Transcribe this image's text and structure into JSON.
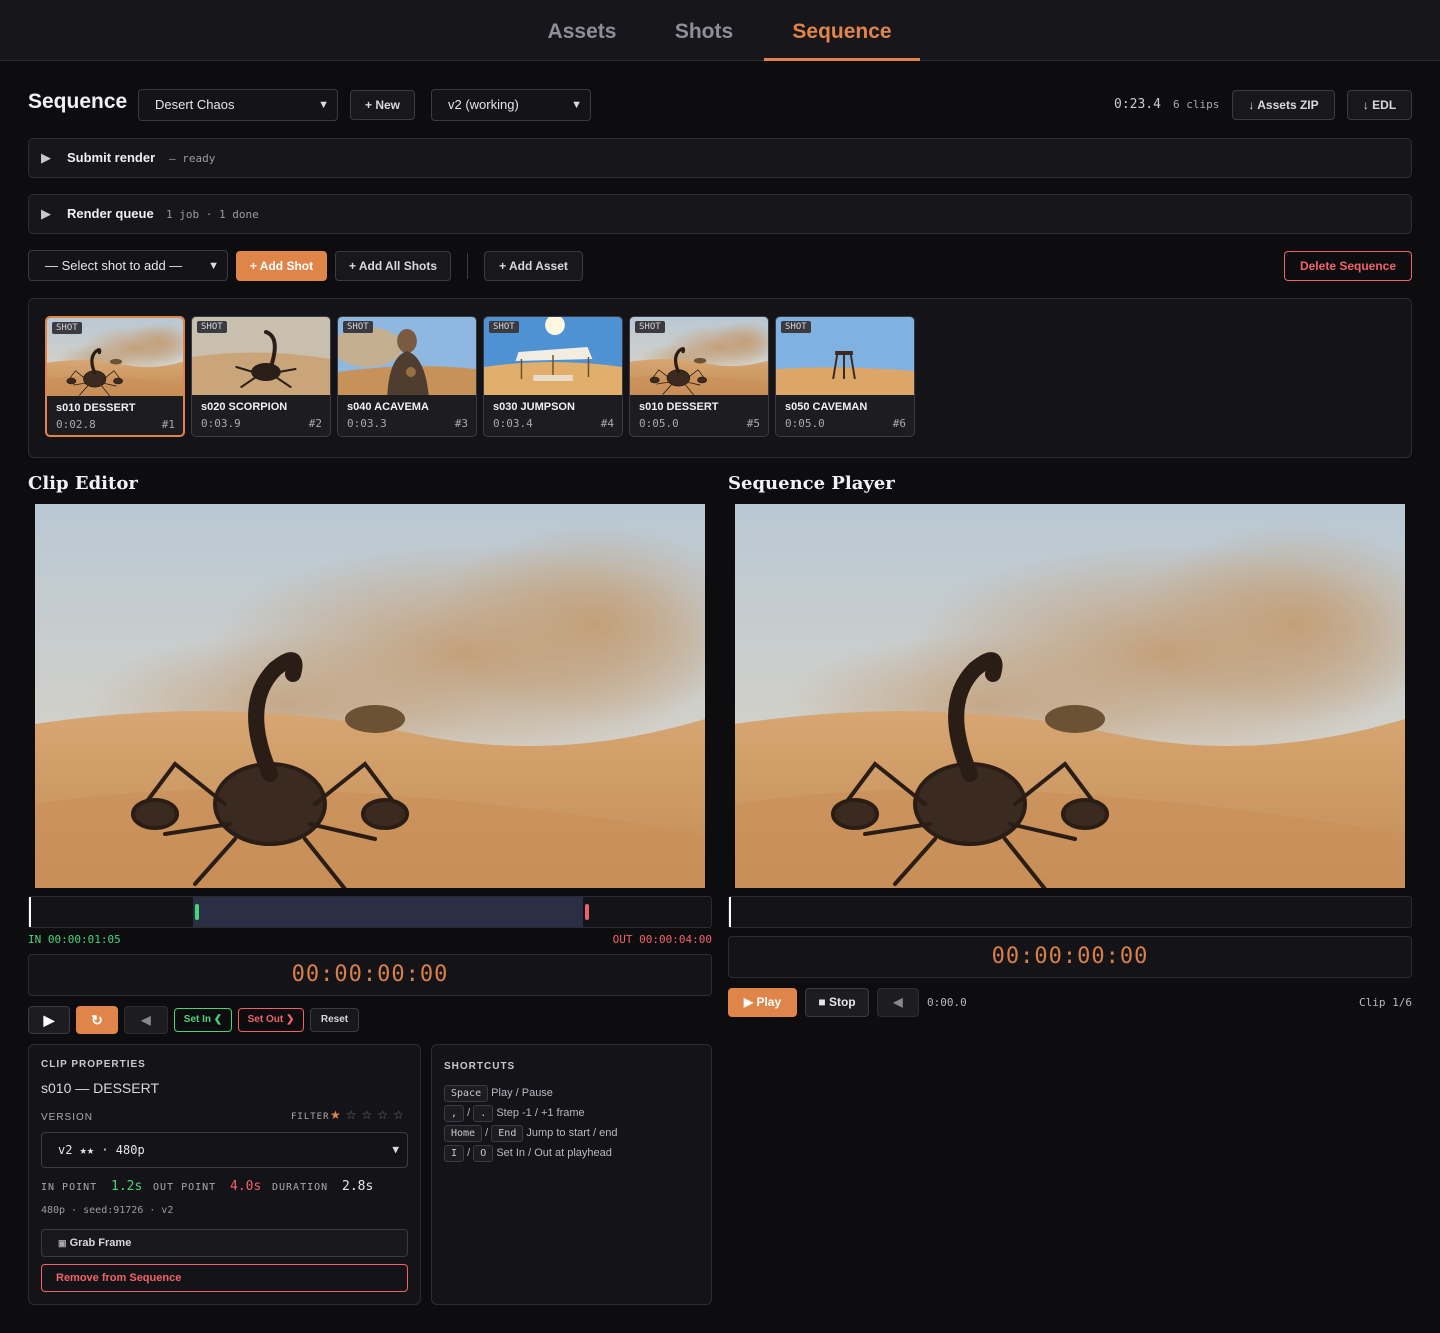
{
  "nav": {
    "tabs": [
      "Assets",
      "Shots",
      "Sequence"
    ],
    "active": "Sequence"
  },
  "header": {
    "title": "Sequence",
    "sequence_select": "Desert Chaos",
    "new_label": "+ New",
    "version_select": "v2 (working)",
    "duration": "0:23.4",
    "clips_count": "6 clips",
    "assets_zip_label": "Assets ZIP",
    "edl_label": "EDL"
  },
  "submit_render": {
    "title": "Submit render",
    "status": "— ready"
  },
  "render_queue": {
    "title": "Render queue",
    "status": "1 job · 1 done"
  },
  "toolbar": {
    "select_shot_placeholder": "— Select shot to add —",
    "add_shot_label": "+ Add Shot",
    "add_all_label": "+ Add All Shots",
    "add_asset_label": "+ Add Asset",
    "delete_label": "Delete Sequence"
  },
  "clips": [
    {
      "badge": "SHOT",
      "name": "s010 DESSERT",
      "duration": "0:02.8",
      "index": "#1",
      "scene": "scorpion"
    },
    {
      "badge": "SHOT",
      "name": "s020 SCORPION",
      "duration": "0:03.9",
      "index": "#2",
      "scene": "scorpion2"
    },
    {
      "badge": "SHOT",
      "name": "s040 ACAVEMA",
      "duration": "0:03.3",
      "index": "#3",
      "scene": "caveman"
    },
    {
      "badge": "SHOT",
      "name": "s030 JUMPSON",
      "duration": "0:03.4",
      "index": "#4",
      "scene": "tent"
    },
    {
      "badge": "SHOT",
      "name": "s010 DESSERT",
      "duration": "0:05.0",
      "index": "#5",
      "scene": "scorpion"
    },
    {
      "badge": "SHOT",
      "name": "s050 CAVEMAN",
      "duration": "0:05.0",
      "index": "#6",
      "scene": "stool"
    }
  ],
  "clip_editor": {
    "title": "Clip Editor",
    "in_label": "IN 00:00:01:05",
    "out_label": "OUT 00:00:04:00",
    "timecode": "00:00:00:00",
    "set_in_label": "Set In ❮",
    "set_out_label": "Set Out ❯",
    "reset_label": "Reset",
    "in_fraction": 0.24,
    "out_fraction": 0.81
  },
  "clip_properties": {
    "heading": "CLIP PROPERTIES",
    "name": "s010 — DESSERT",
    "version_label": "VERSION",
    "filter_label": "FILTER",
    "filter_stars": 1,
    "version_select": "v2 ★★ · 480p",
    "in_point_label": "IN POINT",
    "in_point": "1.2s",
    "out_point_label": "OUT POINT",
    "out_point": "4.0s",
    "duration_label": "DURATION",
    "duration": "2.8s",
    "info": "480p · seed:91726 · v2",
    "grab_frame_label": "Grab Frame",
    "remove_label": "Remove from Sequence"
  },
  "shortcuts": {
    "heading": "SHORTCUTS",
    "rows": [
      {
        "keys": [
          "Space"
        ],
        "desc": "Play / Pause"
      },
      {
        "keys": [
          ",",
          "."
        ],
        "desc": "Step -1 / +1 frame"
      },
      {
        "keys": [
          "Home",
          "End"
        ],
        "desc": "Jump to start / end"
      },
      {
        "keys": [
          "I",
          "O"
        ],
        "desc": "Set In / Out at playhead"
      }
    ]
  },
  "sequence_player": {
    "title": "Sequence Player",
    "timecode": "00:00:00:00",
    "play_label": "▶ Play",
    "stop_label": "■ Stop",
    "time": "0:00.0",
    "clip_label": "Clip 1/6"
  },
  "colors": {
    "accent": "#e0854a",
    "in_green": "#4cd37a",
    "out_red": "#f0626a",
    "bg": "#0d0d10"
  }
}
